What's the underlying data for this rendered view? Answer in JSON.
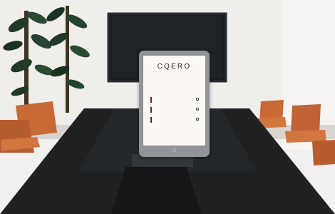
{
  "photo": {
    "wall_color": "#f0eeeb",
    "table_color": "#1f2123",
    "chair_color": "#c86a36",
    "plant_color": "#1f3a26",
    "tv_color": "#1a1c1e"
  },
  "tablet": {
    "screen": {
      "brand": "CQERO",
      "question": "",
      "options": [
        {
          "label": "",
          "selected": true
        },
        {
          "label": "",
          "selected": false
        },
        {
          "label": "",
          "selected": false
        }
      ],
      "actions": {
        "left": "",
        "right": ""
      }
    }
  }
}
